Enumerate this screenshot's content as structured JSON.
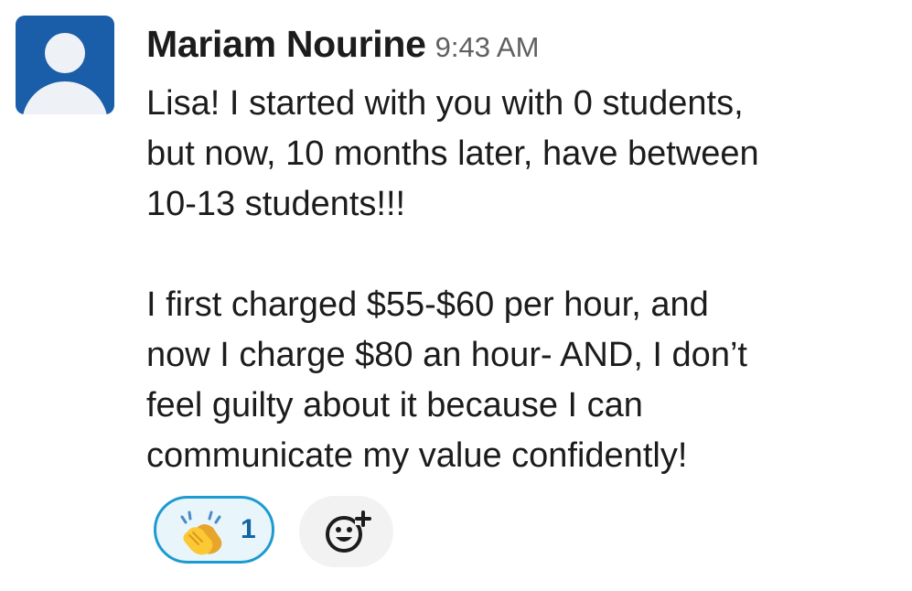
{
  "message": {
    "sender": "Mariam Nourine",
    "timestamp": "9:43 AM",
    "paragraph1": [
      "Lisa! I started with you with 0 students,",
      "but now, 10 months later, have between",
      "10-13 students!!!"
    ],
    "paragraph2": [
      "I first charged $55-$60 per hour, and",
      "now I charge $80 an hour- AND, I don’t",
      "feel guilty about it because I can",
      "communicate my value confidently!"
    ]
  },
  "reactions": [
    {
      "icon": "clapping-hands-emoji",
      "count": "1",
      "selected": true
    }
  ],
  "add_reaction": {
    "icon": "add-reaction-icon"
  },
  "colors": {
    "avatar_bg": "#1a5da8",
    "reaction_border": "#1d9bd1",
    "reaction_bg": "#e8f5fa",
    "reaction_count": "#1264a3",
    "timestamp": "#616061",
    "text": "#1d1c1d"
  }
}
